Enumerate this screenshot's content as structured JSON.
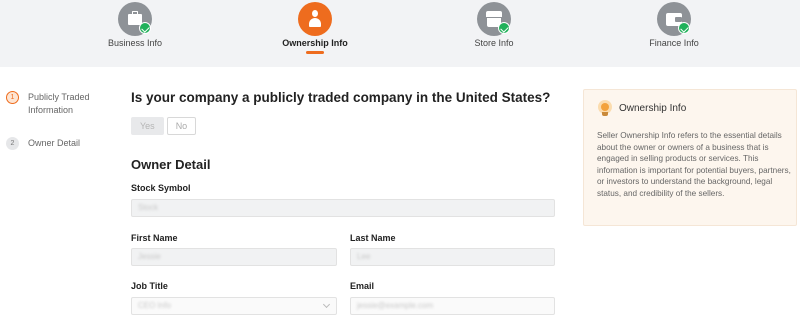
{
  "steps": [
    {
      "label": "Business Info",
      "icon": "briefcase-icon",
      "state": "done"
    },
    {
      "label": "Ownership Info",
      "icon": "person-icon",
      "state": "active"
    },
    {
      "label": "Store Info",
      "icon": "store-icon",
      "state": "done"
    },
    {
      "label": "Finance Info",
      "icon": "wallet-icon",
      "state": "done"
    }
  ],
  "sidenav": {
    "items": [
      {
        "num": "1",
        "label": "Publicly Traded Information",
        "active": true
      },
      {
        "num": "2",
        "label": "Owner Detail",
        "active": false
      }
    ]
  },
  "form": {
    "question": "Is your company a publicly traded company in the United States?",
    "yes_label": "Yes",
    "no_label": "No",
    "selected": "Yes",
    "section_title": "Owner Detail",
    "stock_symbol": {
      "label": "Stock Symbol",
      "value": "Stock"
    },
    "first_name": {
      "label": "First Name",
      "value": "Jessie"
    },
    "last_name": {
      "label": "Last Name",
      "value": "Lee"
    },
    "job_title": {
      "label": "Job Title",
      "value": "CEO Info"
    },
    "email": {
      "label": "Email",
      "value": "jessie@example.com"
    }
  },
  "info_card": {
    "title": "Ownership Info",
    "icon": "lightbulb-icon",
    "text": "Seller Ownership Info refers to the essential details about the owner or owners of a business that is engaged in selling products or services. This information is important for potential buyers, partners, or investors to understand the background, legal status, and credibility of the sellers."
  },
  "colors": {
    "accent": "#ee6c1e",
    "done": "#20b15a",
    "inactive_step": "#8e9297",
    "card_bg": "#fdf6ee"
  }
}
